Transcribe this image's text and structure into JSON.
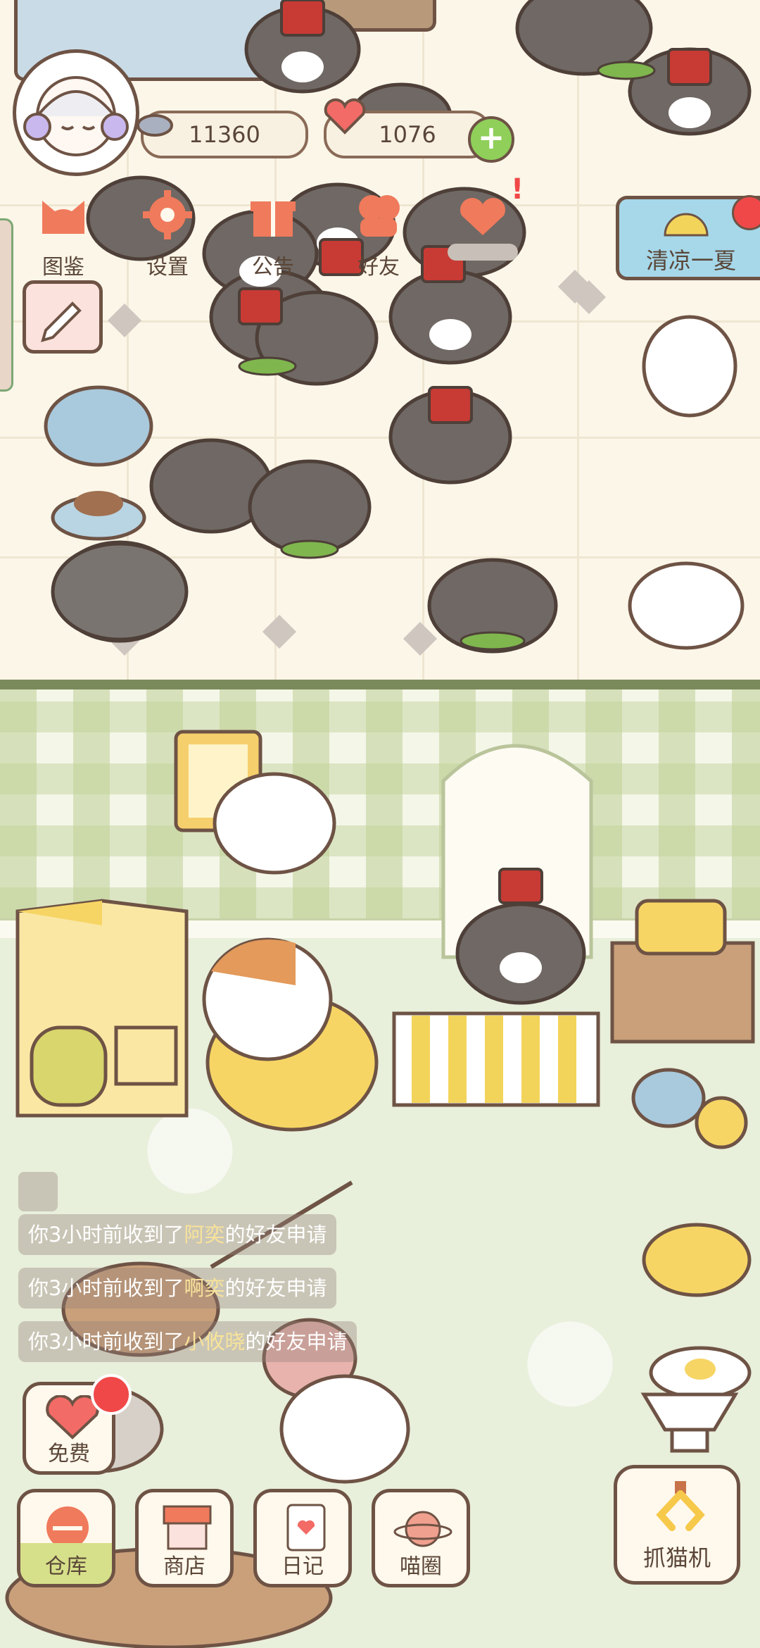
{
  "profile": {
    "coins": "11360",
    "hearts": "1076",
    "add_symbol": "+"
  },
  "top_menu": [
    {
      "label": "图鉴",
      "icon": "cat-face-icon"
    },
    {
      "label": "设置",
      "icon": "gear-icon"
    },
    {
      "label": "公告",
      "icon": "gift-icon"
    },
    {
      "label": "好友",
      "icon": "friends-icon"
    },
    {
      "label": "",
      "icon": "heart-message-icon"
    }
  ],
  "event_banner": {
    "label": "清凉一夏"
  },
  "chat_messages": [
    {
      "prefix": "你3小时前收到了",
      "name": "阿奕",
      "suffix": "的好友申请"
    },
    {
      "prefix": "你3小时前收到了",
      "name": "啊奕",
      "suffix": "的好友申请"
    },
    {
      "prefix": "你3小时前收到了",
      "name": "小攸晓",
      "suffix": "的好友申请"
    }
  ],
  "free_button": {
    "label": "免费"
  },
  "bottom_nav": [
    {
      "label": "仓库",
      "icon": "warehouse-icon"
    },
    {
      "label": "商店",
      "icon": "shop-icon"
    },
    {
      "label": "日记",
      "icon": "diary-icon"
    },
    {
      "label": "喵圈",
      "icon": "planet-icon"
    }
  ],
  "claw_machine": {
    "label": "抓猫机",
    "icon": "claw-icon"
  },
  "colors": {
    "accent": "#f07a5c",
    "outline": "#6e5345",
    "panel": "#fff8ec",
    "highlight_name": "#f8e39a",
    "badge_red": "#f04848"
  }
}
